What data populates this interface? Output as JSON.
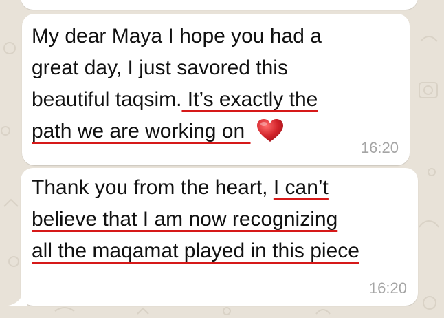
{
  "colors": {
    "background": "#e8e2d8",
    "bubble": "#ffffff",
    "text": "#111111",
    "timestamp": "#a5a5a5",
    "underline": "#d61919",
    "heart": "#d2232a"
  },
  "messages": [
    {
      "lines": [
        {
          "plain": "My dear Maya I hope you had a",
          "underlined": ""
        },
        {
          "plain": "great day, I just savored this",
          "underlined": ""
        },
        {
          "plain": "beautiful taqsim.",
          "underlined": " It’s exactly the"
        },
        {
          "plain": "",
          "underlined": "path we are working on "
        }
      ],
      "emoji": "heart-emoji",
      "time": "16:20"
    },
    {
      "lines": [
        {
          "plain": "Thank you from the heart, ",
          "underlined": "I can’t"
        },
        {
          "plain": "",
          "underlined": "believe that I am now recognizing"
        },
        {
          "plain": "",
          "underlined": "all the maqamat played in this piece"
        }
      ],
      "time": "16:20"
    }
  ]
}
